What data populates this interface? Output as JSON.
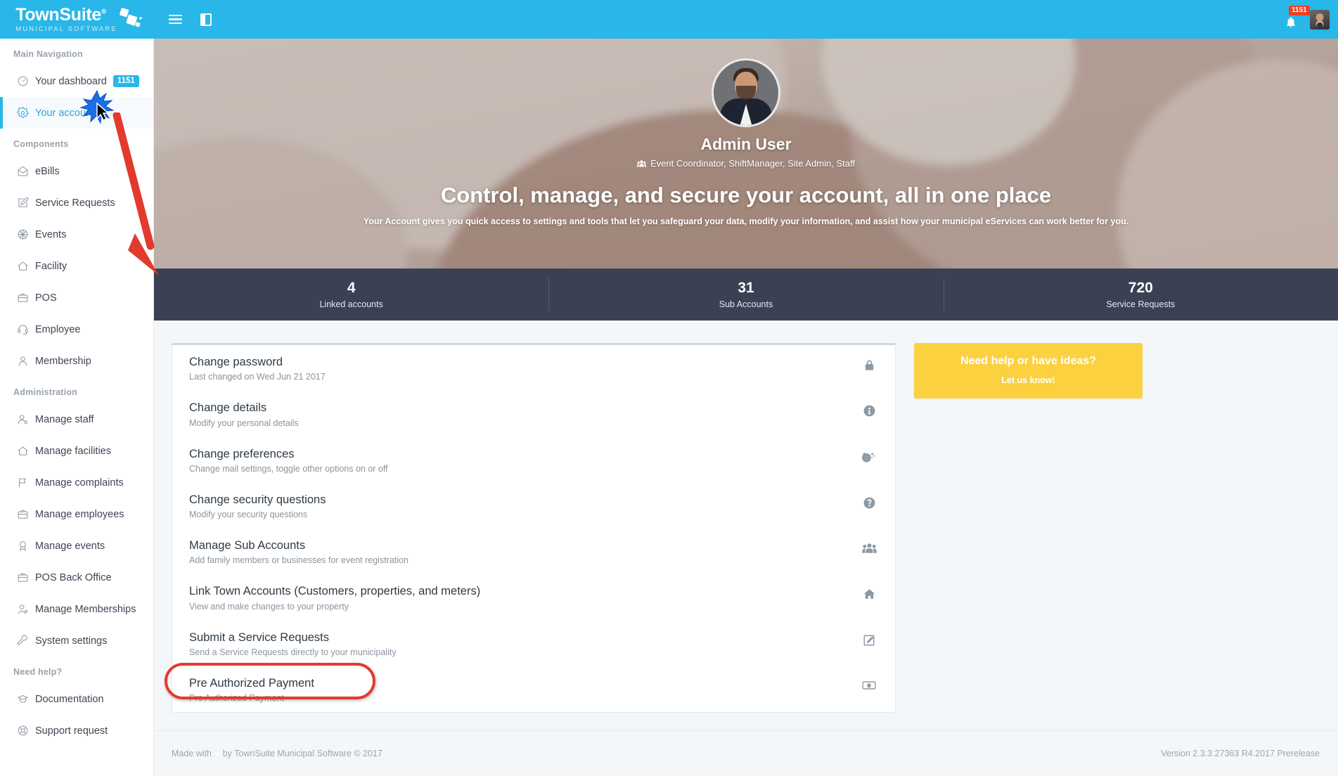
{
  "topbar": {
    "logo_name": "TownSuite",
    "logo_registered": "®",
    "logo_subtitle": "MUNICIPAL SOFTWARE",
    "menu_icon": "hamburger-icon",
    "sidebar_toggle_icon": "sidebar-toggle-icon",
    "notification_count": "1151",
    "brand_color": "#29b6e8",
    "badge_color": "#f04124"
  },
  "sidebar": {
    "sections": [
      {
        "title": "Main Navigation",
        "items": [
          {
            "label": "Your dashboard",
            "icon": "dashboard-gauge-icon",
            "badge": "1151",
            "active": false
          },
          {
            "label": "Your account",
            "icon": "gear-icon",
            "badge": "",
            "active": true
          }
        ]
      },
      {
        "title": "Components",
        "items": [
          {
            "label": "eBills",
            "icon": "envelope-open-icon",
            "badge": "",
            "active": false
          },
          {
            "label": "Service Requests",
            "icon": "pencil-square-icon",
            "badge": "",
            "active": false
          },
          {
            "label": "Events",
            "icon": "ball-icon",
            "badge": "",
            "active": false
          },
          {
            "label": "Facility",
            "icon": "home-icon",
            "badge": "",
            "active": false
          },
          {
            "label": "POS",
            "icon": "briefcase-icon",
            "badge": "",
            "active": false
          },
          {
            "label": "Employee",
            "icon": "headset-icon",
            "badge": "",
            "active": false
          },
          {
            "label": "Membership",
            "icon": "user-icon",
            "badge": "",
            "active": false
          }
        ]
      },
      {
        "title": "Administration",
        "items": [
          {
            "label": "Manage staff",
            "icon": "user-gear-icon",
            "badge": "",
            "active": false
          },
          {
            "label": "Manage facilities",
            "icon": "home-icon",
            "badge": "",
            "active": false
          },
          {
            "label": "Manage complaints",
            "icon": "flag-icon",
            "badge": "",
            "active": false
          },
          {
            "label": "Manage employees",
            "icon": "briefcase-icon",
            "badge": "",
            "active": false
          },
          {
            "label": "Manage events",
            "icon": "award-icon",
            "badge": "",
            "active": false
          },
          {
            "label": "POS Back Office",
            "icon": "briefcase-icon",
            "badge": "",
            "active": false
          },
          {
            "label": "Manage Memberships",
            "icon": "user-plus-icon",
            "badge": "",
            "active": false
          },
          {
            "label": "System settings",
            "icon": "wrench-icon",
            "badge": "",
            "active": false
          }
        ]
      },
      {
        "title": "Need help?",
        "items": [
          {
            "label": "Documentation",
            "icon": "graduation-cap-icon",
            "badge": "",
            "active": false
          },
          {
            "label": "Support request",
            "icon": "lifebuoy-icon",
            "badge": "",
            "active": false
          }
        ]
      }
    ]
  },
  "hero": {
    "avatar_alt": "Admin User profile photo",
    "name": "Admin User",
    "roles_icon": "users-icon",
    "roles": "Event Coordinator, ShiftManager, Site Admin, Staff",
    "title": "Control, manage, and secure your account, all in one place",
    "subtitle": "Your Account gives you quick access to settings and tools that let you safeguard your data, modify your information, and assist how your municipal eServices can work better for you."
  },
  "stats": {
    "bar_color": "#3b4155",
    "items": [
      {
        "value": "4",
        "label": "Linked accounts"
      },
      {
        "value": "31",
        "label": "Sub Accounts"
      },
      {
        "value": "720",
        "label": "Service Requests"
      }
    ]
  },
  "account_options": [
    {
      "title": "Change password",
      "desc": "Last changed on Wed Jun 21 2017",
      "icon": "lock-icon",
      "highlighted": false
    },
    {
      "title": "Change details",
      "desc": "Modify your personal details",
      "icon": "info-circle-icon",
      "highlighted": false
    },
    {
      "title": "Change preferences",
      "desc": "Change mail settings, toggle other options on or off",
      "icon": "gears-icon",
      "highlighted": false
    },
    {
      "title": "Change security questions",
      "desc": "Modify your security questions",
      "icon": "question-circle-icon",
      "highlighted": false
    },
    {
      "title": "Manage Sub Accounts",
      "desc": "Add family members or businesses for event registration",
      "icon": "users-group-icon",
      "highlighted": false
    },
    {
      "title": "Link Town Accounts (Customers, properties, and meters)",
      "desc": "View and make changes to your property",
      "icon": "home-icon",
      "highlighted": false
    },
    {
      "title": "Submit a Service Requests",
      "desc": "Send a Service Requests directly to your municipality",
      "icon": "pencil-square-icon",
      "highlighted": false
    },
    {
      "title": "Pre Authorized Payment",
      "desc": "Pre Authorized Payment",
      "icon": "money-bill-icon",
      "highlighted": true
    }
  ],
  "help_card": {
    "title": "Need help or have ideas?",
    "subtitle": "Let us know!",
    "color": "#fbd140"
  },
  "footer": {
    "left_prefix": "Made with",
    "heart_icon": "heart-icon",
    "left_suffix": "by TownSuite Municipal Software © 2017",
    "right": "Version 2.3.3.27363 R4.2017 Prerelease"
  },
  "annotations": {
    "arrow_color": "#e23b2e",
    "ellipse_color": "#e23b2e",
    "cursor_icon": "cursor-click-burst"
  }
}
